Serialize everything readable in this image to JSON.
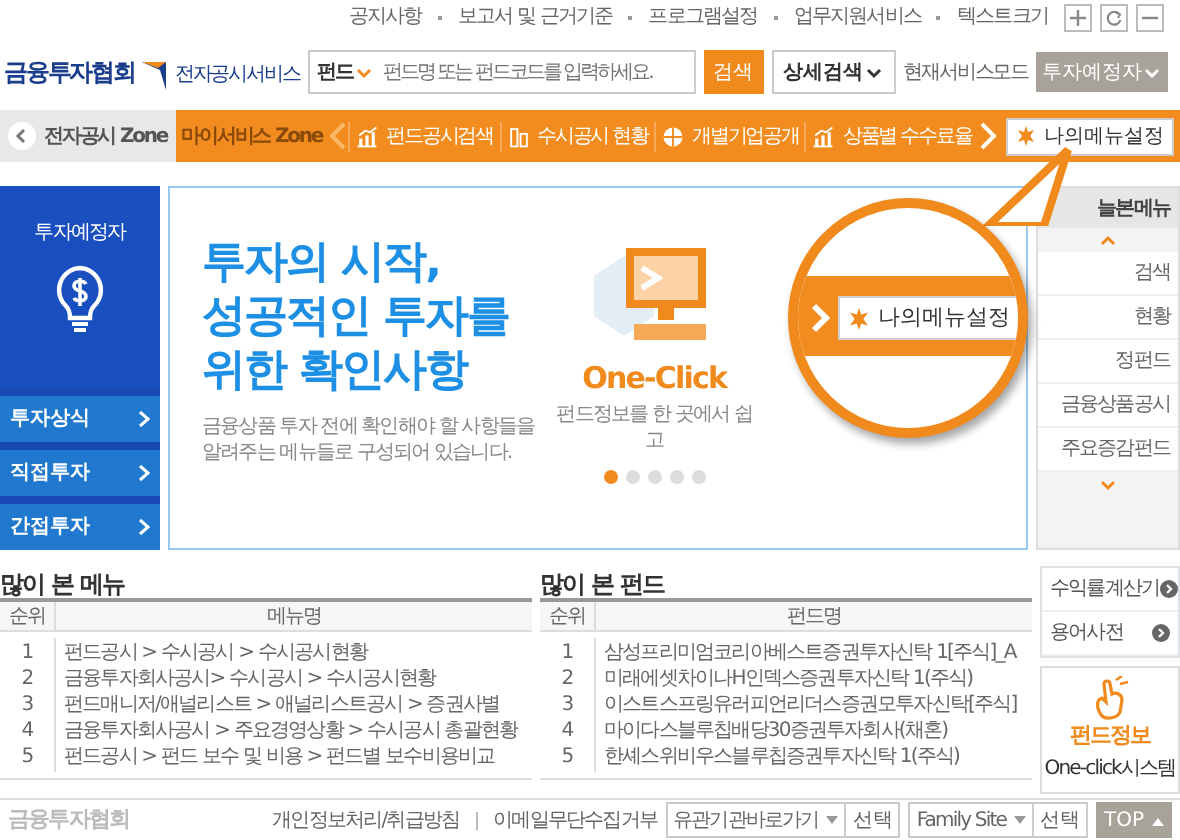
{
  "top_links": [
    "공지사항",
    "보고서 및 근거기준",
    "프로그램설정",
    "업무지원서비스",
    "텍스트크기"
  ],
  "header": {
    "logo": "금융투자협회",
    "logo_sub": "전자공시서비스",
    "search": {
      "category": "펀드",
      "placeholder": "펀드명 또는 펀드코드를 입력하세요.",
      "button": "검색",
      "detail_button": "상세검색"
    },
    "mode_label": "현재서비스모드",
    "mode": "투자예정자"
  },
  "nav": {
    "zone_left": "전자공시 Zone",
    "zone": "마이서비스 Zone",
    "items": [
      {
        "label": "펀드공시검색",
        "kind": "chart"
      },
      {
        "label": "수시공시 현황",
        "kind": "building"
      },
      {
        "label": "개별기업공개",
        "kind": "globe"
      },
      {
        "label": "상품별 수수료율",
        "kind": "chart"
      }
    ],
    "settings_button": "나의메뉴설정"
  },
  "sidebar": {
    "title": "투자예정자",
    "items": [
      "투자상식",
      "직접투자",
      "간접투자"
    ]
  },
  "banner": {
    "headline": [
      "투자의 시작,",
      "성공적인 투자를",
      "위한 확인사항"
    ],
    "body": [
      "금융상품 투자 전에 확인해야 할 사항들을",
      "알려주는 메뉴들로 구성되어 있습니다."
    ],
    "slide_title": "One-Click",
    "slide_caption": "펀드정보를 한 곳에서 쉽고",
    "dots": [
      {
        "selected": true
      },
      {
        "selected": false
      },
      {
        "selected": false
      },
      {
        "selected": false
      },
      {
        "selected": false
      }
    ]
  },
  "callout": {
    "button": "나의메뉴설정"
  },
  "recent_menu": {
    "title": "늘본메뉴",
    "items": [
      "검색",
      "현황",
      "정펀드",
      "금융상품공시",
      "주요증감펀드"
    ]
  },
  "top_menus": {
    "title": "많이 본 메뉴",
    "columns": [
      "순위",
      "메뉴명"
    ],
    "rows": [
      [
        "1",
        "펀드공시 > 수시공시 > 수시공시현황"
      ],
      [
        "2",
        "금융투자회사공시> 수시공시 > 수시공시현황"
      ],
      [
        "3",
        "펀드매니저/애널리스트 > 애널리스트공시 > 증권사별"
      ],
      [
        "4",
        "금융투자회사공시 > 주요경영상황 > 수시공시 총괄현황"
      ],
      [
        "5",
        "펀드공시 > 펀드 보수 및 비용 > 펀드별 보수비용비교"
      ]
    ]
  },
  "top_funds": {
    "title": "많이 본 펀드",
    "columns": [
      "순위",
      "펀드명"
    ],
    "rows": [
      [
        "1",
        "삼성프리미엄코리아베스트증권투자신탁 1[주식]_A"
      ],
      [
        "2",
        "미래에셋차이나H인덱스증권투자신탁 1(주식)"
      ],
      [
        "3",
        "이스트스프링유러피언리더스증권모투자신탁[주식]"
      ],
      [
        "4",
        "마이다스블루칩배당30증권투자회사(채혼)"
      ],
      [
        "5",
        "한셰스위비우스블루칩증권투자신탁 1(주식)"
      ]
    ]
  },
  "tools": [
    "수익률계산기",
    "용어사전"
  ],
  "promo": {
    "title": "펀드정보",
    "subtitle": "One-click시스템"
  },
  "footer": {
    "logo": "금융투자협회",
    "links": [
      "개인정보처리/취급방침",
      "이메일무단수집거부"
    ],
    "selects": [
      {
        "value": "유관기관바로가기",
        "button": "선택"
      },
      {
        "value": "Family Site",
        "button": "선택"
      }
    ],
    "top_button": "TOP"
  }
}
